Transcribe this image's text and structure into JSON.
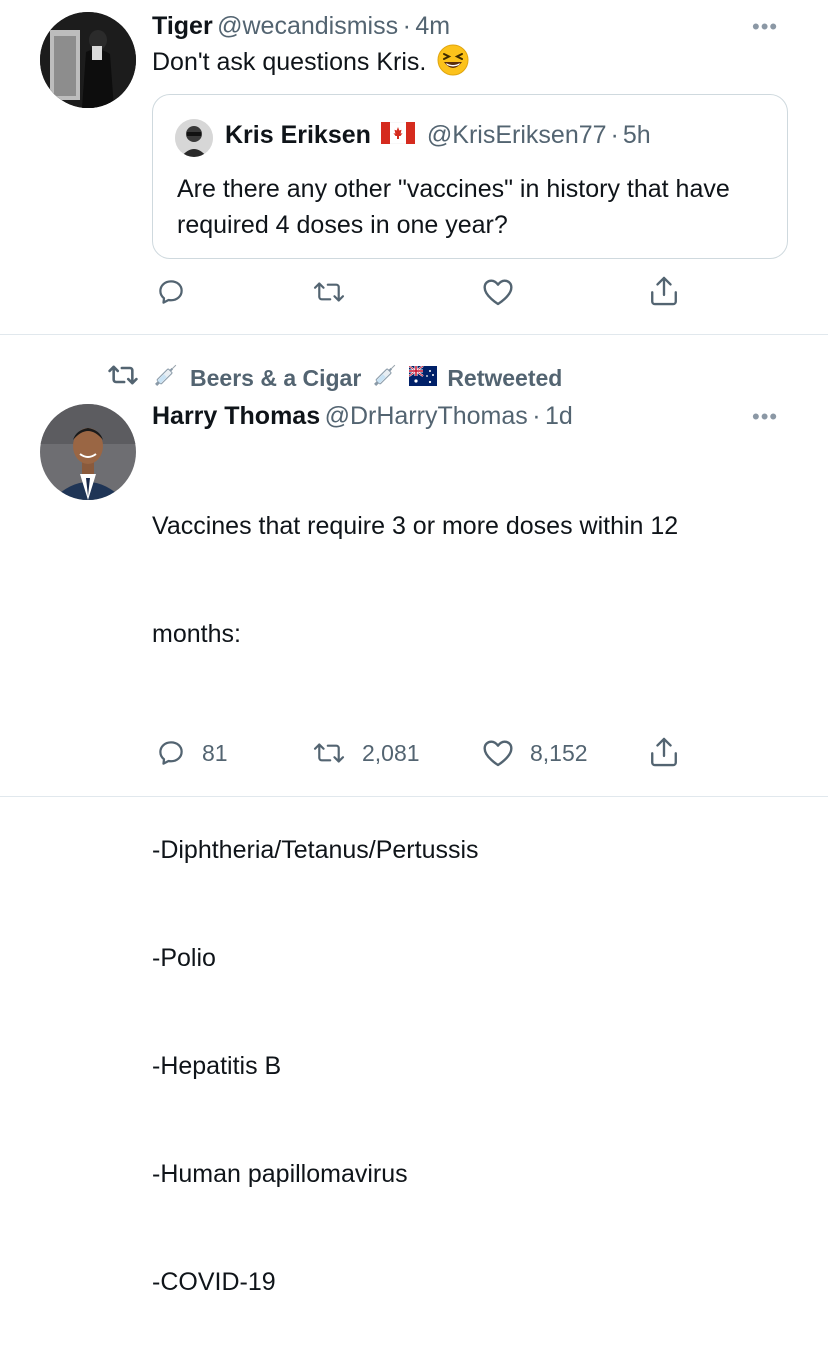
{
  "tweet1": {
    "name": "Tiger",
    "handle": "@wecandismiss",
    "dot": "·",
    "time": "4m",
    "text": "Don't ask questions Kris.",
    "emoji_icon": "grinning-squinting-face-icon",
    "quote": {
      "name": "Kris Eriksen",
      "flag_icon": "canada-flag-icon",
      "handle": "@KrisEriksen77",
      "dot": "·",
      "time": "5h",
      "text": "Are there any other \"vaccines\" in history that have required 4 doses in one year?"
    }
  },
  "tweet2": {
    "retweet": {
      "retweeter": "Beers & a Cigar",
      "label": "Retweeted",
      "icons": [
        "syringe-icon",
        "syringe-icon",
        "australia-flag-icon"
      ]
    },
    "name": "Harry Thomas",
    "handle": "@DrHarryThomas",
    "dot": "·",
    "time": "1d",
    "text_line1": "Vaccines that require 3 or more doses within 12",
    "text_line2": "months:",
    "list": [
      "-Diphtheria/Tetanus/Pertussis",
      "-Polio",
      "-Hepatitis B",
      "-Human papillomavirus",
      "-COVID-19"
    ],
    "replies": "81",
    "retweets": "2,081",
    "likes": "8,152"
  },
  "colors": {
    "text": "#0f1419",
    "secondary": "#536471",
    "border": "#cfd9de",
    "canada_red": "#d52b1e",
    "australia_blue": "#012169"
  }
}
